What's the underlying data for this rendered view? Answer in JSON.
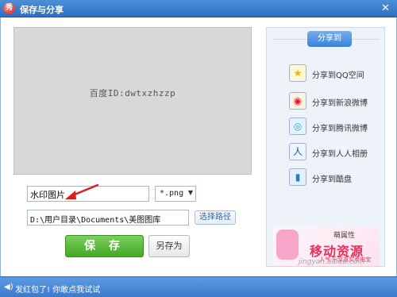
{
  "window": {
    "title": "保存与分享",
    "logo_glyph": "秀",
    "close_glyph": "✕"
  },
  "preview": {
    "watermark_text": "百度ID:dwtxzhzzp"
  },
  "form": {
    "file_name": "水印图片",
    "format": "*.png",
    "save_path": "D:\\用户目录\\Documents\\美图图库",
    "choose_path_label": "选择路径",
    "save_label": "保 存",
    "save_as_label": "另存为"
  },
  "share": {
    "header": "分享到",
    "items": [
      {
        "label": "分享到QQ空间",
        "icon": "qzone-star-icon",
        "glyph": "★",
        "color": "#f2b400"
      },
      {
        "label": "分享到新浪微博",
        "icon": "sina-weibo-icon",
        "glyph": "◉",
        "color": "#e6162d"
      },
      {
        "label": "分享到腾讯微博",
        "icon": "tencent-weibo-icon",
        "glyph": "◎",
        "color": "#2c9ee0"
      },
      {
        "label": "分享到人人相册",
        "icon": "renren-icon",
        "glyph": "人",
        "color": "#1a56b0"
      },
      {
        "label": "分享到酷盘",
        "icon": "kupan-icon",
        "glyph": "▮",
        "color": "#1a7fd4"
      }
    ]
  },
  "ad": {
    "small_text": "萌属性",
    "brand": "移动资源",
    "sub": "人气·乐享真实卖电宝",
    "site": "jingyan.baidu.com"
  },
  "status": {
    "text": "发红包了! 你敢点我试试"
  },
  "colors": {
    "title_bar": "#2f6fc2",
    "save_button": "#43a826",
    "annotation_arrow": "#d81e1e"
  }
}
